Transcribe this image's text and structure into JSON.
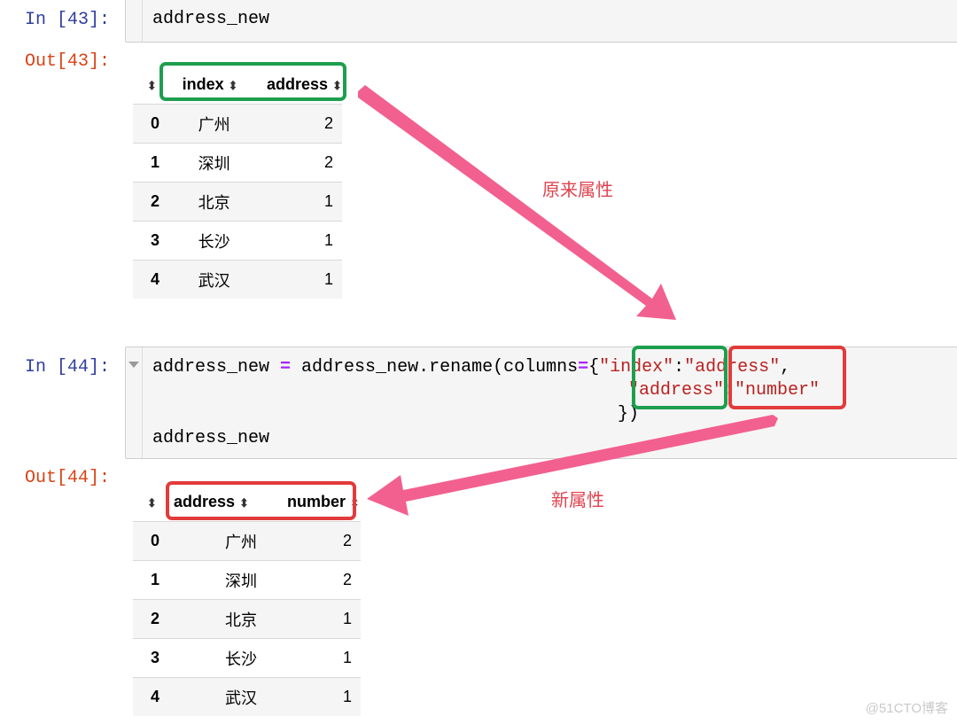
{
  "cells": [
    {
      "in_prompt": "In [43]:",
      "code_lines": [
        "address_new"
      ],
      "out_prompt": "Out[43]:",
      "table": {
        "columns": [
          "index",
          "address"
        ],
        "rows": [
          {
            "idx": "0",
            "c1": "广州",
            "c2": "2"
          },
          {
            "idx": "1",
            "c1": "深圳",
            "c2": "2"
          },
          {
            "idx": "2",
            "c1": "北京",
            "c2": "1"
          },
          {
            "idx": "3",
            "c1": "长沙",
            "c2": "1"
          },
          {
            "idx": "4",
            "c1": "武汉",
            "c2": "1"
          }
        ]
      }
    },
    {
      "in_prompt": "In [44]:",
      "code": {
        "line1_prefix": "address_new ",
        "line1_op": "=",
        "line1_mid": " address_new.rename(columns",
        "line1_op2": "=",
        "line1_brace": "{",
        "line1_key": "\"index\"",
        "line1_colon": ":",
        "line1_val": "\"address\"",
        "line1_comma": ",",
        "line2_key": "\"address\"",
        "line2_colon": ":",
        "line2_val": "\"number\"",
        "line3": "})",
        "line4": "address_new"
      },
      "out_prompt": "Out[44]:",
      "table": {
        "columns": [
          "address",
          "number"
        ],
        "rows": [
          {
            "idx": "0",
            "c1": "广州",
            "c2": "2"
          },
          {
            "idx": "1",
            "c1": "深圳",
            "c2": "2"
          },
          {
            "idx": "2",
            "c1": "北京",
            "c2": "1"
          },
          {
            "idx": "3",
            "c1": "长沙",
            "c2": "1"
          },
          {
            "idx": "4",
            "c1": "武汉",
            "c2": "1"
          }
        ]
      }
    }
  ],
  "annotations": {
    "original_label": "原来属性",
    "new_label": "新属性",
    "arrow_color": "#f2608f",
    "green_box_color": "#1e9e4e",
    "red_box_color": "#e23b3b"
  },
  "icons": {
    "sort": "⬍",
    "fold": "fold-triangle"
  },
  "watermark": "@51CTO博客"
}
